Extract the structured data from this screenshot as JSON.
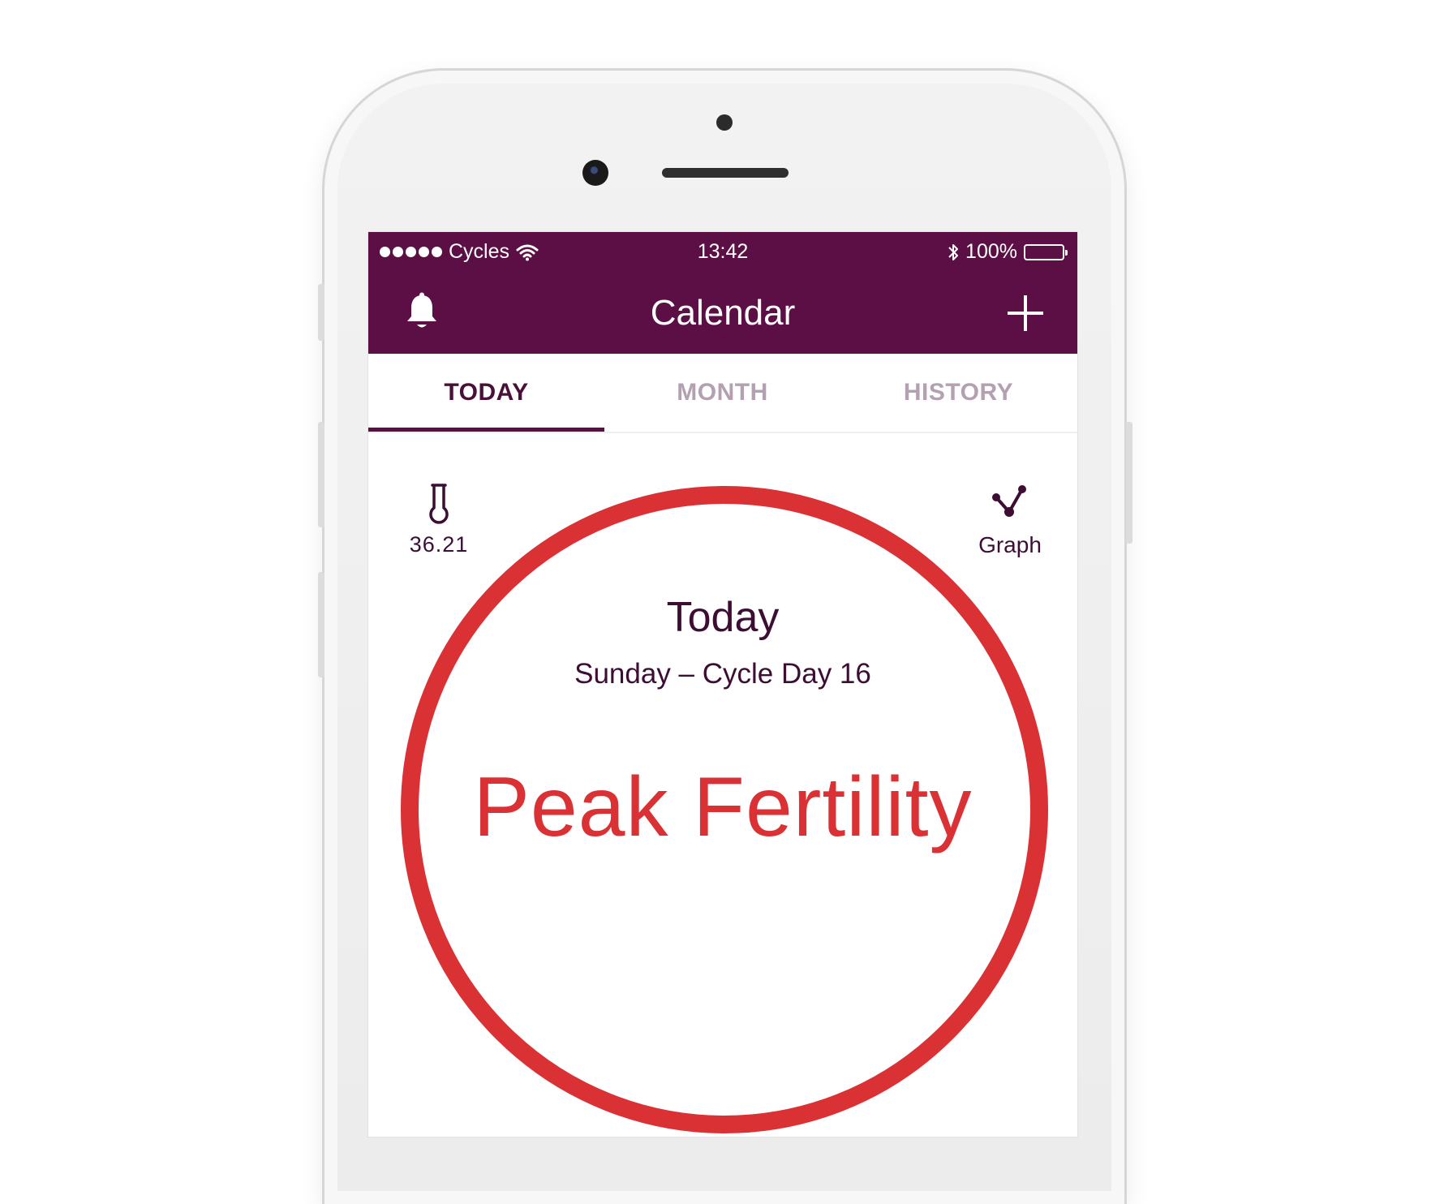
{
  "status_bar": {
    "carrier": "Cycles",
    "time": "13:42",
    "battery": "100%"
  },
  "nav": {
    "title": "Calendar"
  },
  "tabs": [
    {
      "label": "TODAY",
      "active": true
    },
    {
      "label": "MONTH",
      "active": false
    },
    {
      "label": "HISTORY",
      "active": false
    }
  ],
  "temperature": {
    "value": "36.21"
  },
  "graph": {
    "label": "Graph"
  },
  "day": {
    "title": "Today",
    "subtitle": "Sunday – Cycle Day 16",
    "fertility_status": "Peak Fertility"
  },
  "colors": {
    "brand": "#5c0f45",
    "accent_red": "#da3135",
    "tab_inactive": "#b3a0b1"
  }
}
